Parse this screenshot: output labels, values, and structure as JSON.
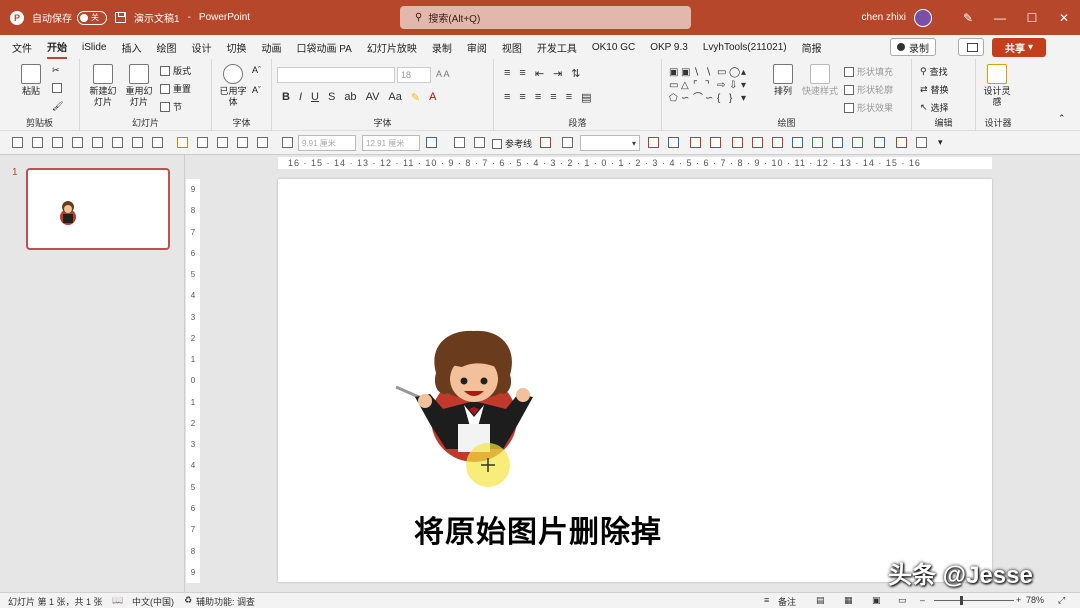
{
  "titlebar": {
    "autosave_label": "自动保存",
    "autosave_state": "关",
    "doc_name": "演示文稿1",
    "separator": "-",
    "app_name": "PowerPoint",
    "search_placeholder": "搜索(Alt+Q)",
    "user": "chen zhixi"
  },
  "menu": [
    "文件",
    "开始",
    "iSlide",
    "插入",
    "绘图",
    "设计",
    "切换",
    "动画",
    "口袋动画 PA",
    "幻灯片放映",
    "录制",
    "审阅",
    "视图",
    "开发工具",
    "OK10 GC",
    "OKP 9.3",
    "LvyhTools(211021)",
    "简报"
  ],
  "menu_right": {
    "record": "录制",
    "share": "共享"
  },
  "ribbon": {
    "paste": "粘贴",
    "new_slide": "新建幻灯片",
    "reuse_slide": "重用幻灯片",
    "layout": "版式",
    "reset": "重置",
    "section": "节",
    "used_font": "已用字体",
    "font_size": "18",
    "arrange": "排列",
    "quick_styles": "快速样式",
    "shape_fill": "形状填充",
    "shape_outline": "形状轮廓",
    "shape_effects": "形状效果",
    "find": "查找",
    "replace": "替换",
    "select": "选择",
    "design_ideas": "设计灵感",
    "groups": {
      "clipboard": "剪贴板",
      "slides": "幻灯片",
      "font_small": "字体",
      "font": "字体",
      "paragraph": "段落",
      "drawing": "绘图",
      "editing": "编辑",
      "designer": "设计器"
    }
  },
  "qtoolbar": {
    "width_value": "9.91 厘米",
    "height_value": "12.91 厘米",
    "reference_line": "参考线"
  },
  "thumbs": [
    {
      "number": "1"
    }
  ],
  "rulers": {
    "h": "16 · 15 · 14 · 13 · 12 · 11 · 10 · 9 · 8 · 7 · 6 · 5 · 4 · 3 · 2 · 1 · 0 · 1 · 2 · 3 · 4 · 5 · 6 · 7 · 8 · 9 · 10 · 11 · 12 · 13 · 14 · 15 · 16",
    "v": [
      "9",
      "8",
      "7",
      "6",
      "5",
      "4",
      "3",
      "2",
      "1",
      "0",
      "1",
      "2",
      "3",
      "4",
      "5",
      "6",
      "7",
      "8",
      "9"
    ]
  },
  "overlay": {
    "caption": "将原始图片删除掉",
    "watermark": "头条 @Jesse"
  },
  "status": {
    "slide_info": "幻灯片 第 1 张，共 1 张",
    "language": "中文(中国)",
    "accessibility": "辅助功能: 调查",
    "notes": "备注",
    "zoom": "78%"
  },
  "colors": {
    "accent": "#b7472a",
    "share_button": "#c43e1c",
    "slide_background": "#ffffff",
    "workspace": "#e6e6e6"
  },
  "icons": [
    "search-icon",
    "save-icon",
    "pen-icon",
    "cut-icon",
    "copy-icon",
    "format-painter-icon",
    "find-icon",
    "replace-icon",
    "select-icon",
    "record-icon",
    "chevron-down-icon"
  ]
}
